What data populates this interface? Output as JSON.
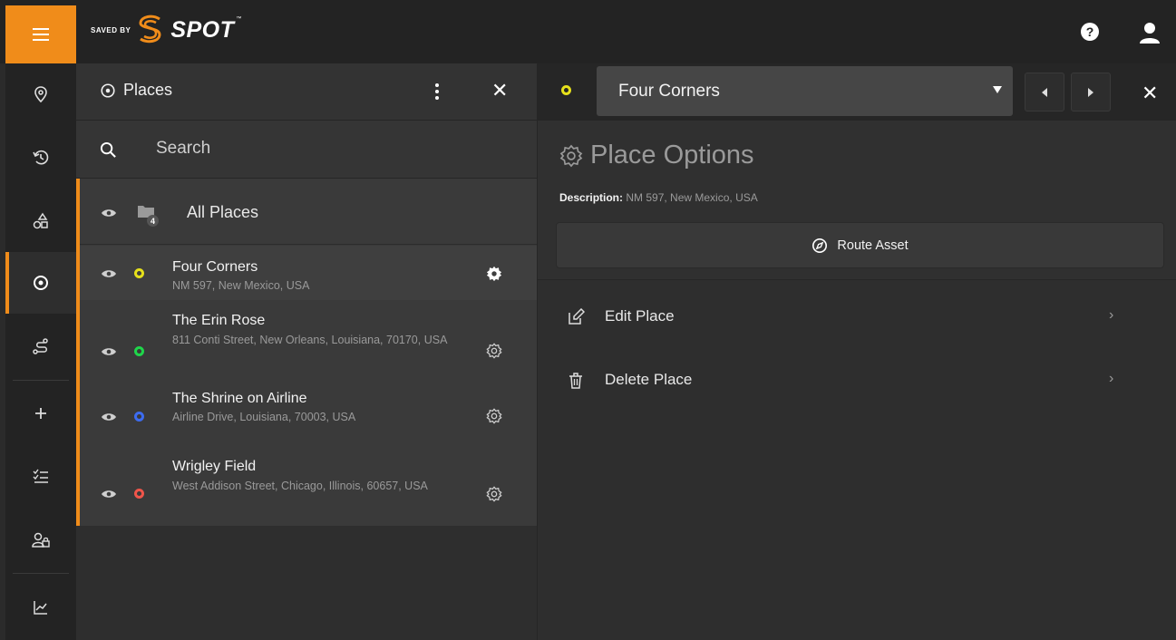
{
  "brand": {
    "saved_by": "SAVED BY",
    "name": "SPOT",
    "tm": "™",
    "accent": "#f08c1a"
  },
  "topbar": {
    "help_icon": "question-circle-icon",
    "user_icon": "user-icon"
  },
  "rail": {
    "items": [
      {
        "name": "map-pin-icon",
        "active": false
      },
      {
        "name": "history-icon",
        "active": false
      },
      {
        "name": "assets-shapes-icon",
        "active": false
      },
      {
        "name": "places-target-icon",
        "active": true
      },
      {
        "name": "route-icon",
        "active": false
      },
      {
        "name": "add-icon",
        "active": false
      },
      {
        "name": "checklist-icon",
        "active": false
      },
      {
        "name": "users-icon",
        "active": false
      },
      {
        "name": "reports-chart-icon",
        "active": false
      }
    ]
  },
  "places_panel": {
    "title": "Places",
    "search_placeholder": "Search",
    "all_places": {
      "label": "All Places",
      "count": "4"
    },
    "places": [
      {
        "name": "Four Corners",
        "address": "NM 597, New Mexico, USA",
        "color": "#e6e01b",
        "selected": true
      },
      {
        "name": "The Erin Rose",
        "address": "811 Conti Street, New Orleans, Louisiana, 70170, USA",
        "color": "#1fd64a",
        "selected": false
      },
      {
        "name": "The Shrine on Airline",
        "address": "Airline Drive, Louisiana, 70003, USA",
        "color": "#3d6cf0",
        "selected": false
      },
      {
        "name": "Wrigley Field",
        "address": "West Addison Street, Chicago, Illinois, 60657, USA",
        "color": "#f0554a",
        "selected": false
      }
    ]
  },
  "detail": {
    "selected_place": "Four Corners",
    "selected_color": "#e6e01b",
    "section_title": "Place Options",
    "description_label": "Description:",
    "description_value": "NM 597, New Mexico, USA",
    "route_button": "Route Asset",
    "options": [
      {
        "label": "Edit Place",
        "icon": "edit-icon"
      },
      {
        "label": "Delete Place",
        "icon": "trash-icon"
      }
    ]
  }
}
